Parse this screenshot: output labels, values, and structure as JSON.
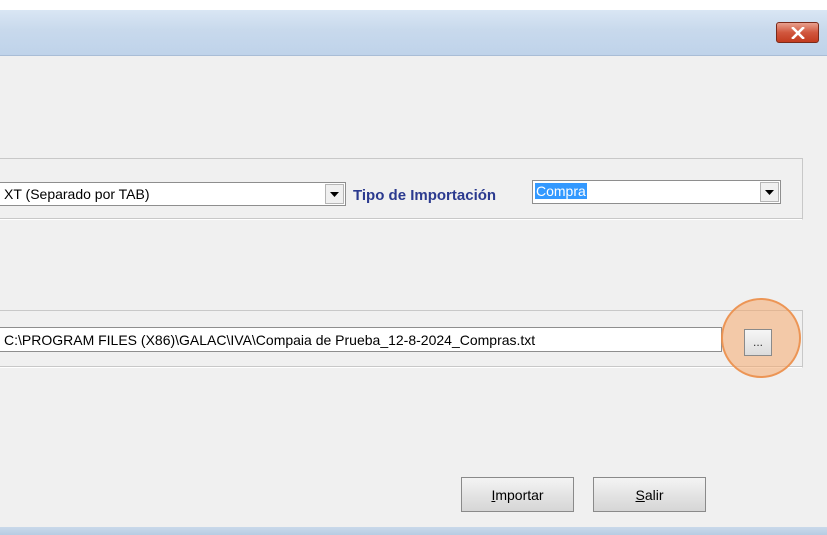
{
  "window": {
    "close_icon": "close-x-icon"
  },
  "format_combo": {
    "value": "XT (Separado por TAB)",
    "arrow_icon": "dropdown-arrow-icon"
  },
  "tipo_importacion": {
    "label": "Tipo de Importación",
    "value": "Compra",
    "arrow_icon": "dropdown-arrow-icon"
  },
  "file_path": {
    "value": "C:\\PROGRAM FILES (X86)\\GALAC\\IVA\\Compaia de Prueba_12-8-2024_Compras.txt",
    "browse_label": "..."
  },
  "buttons": {
    "importar_mnemonic": "I",
    "importar_rest": "mportar",
    "salir_mnemonic": "S",
    "salir_rest": "alir"
  },
  "colors": {
    "label_color": "#2b3a8f",
    "selection": "#3399ff",
    "highlight": "#f5aa6e",
    "close_button": "#c23b1f"
  }
}
